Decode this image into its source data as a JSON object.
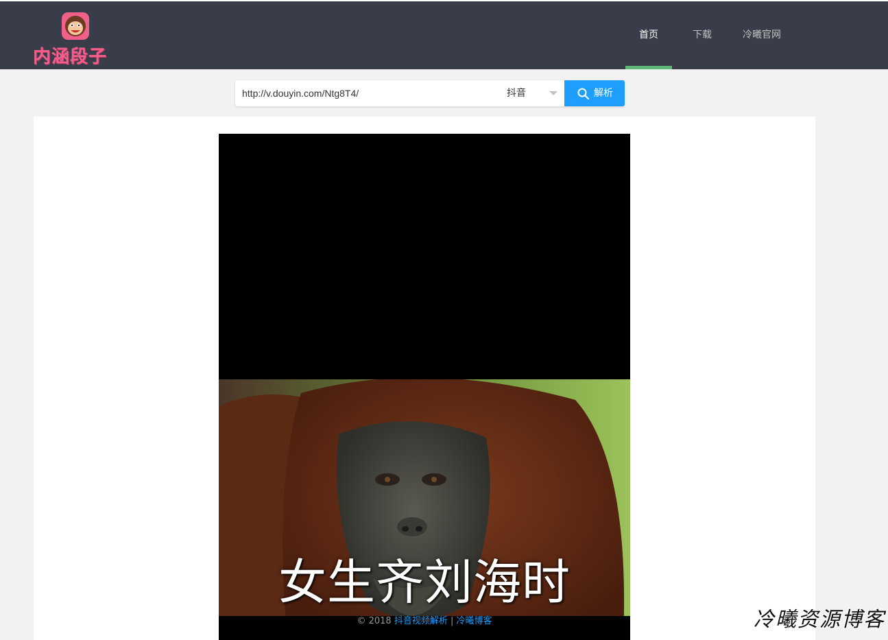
{
  "brand": {
    "name": "内涵段子"
  },
  "nav": {
    "items": [
      {
        "label": "首页",
        "active": true
      },
      {
        "label": "下载",
        "active": false
      },
      {
        "label": "冷曦官网",
        "active": false
      }
    ]
  },
  "search": {
    "url_value": "http://v.douyin.com/Ntg8T4/",
    "platform_selected": "抖音",
    "button_label": "解析"
  },
  "video": {
    "subtitle": "女生齐刘海时"
  },
  "footer": {
    "copyright": "© 2018",
    "link1": "抖音视频解析",
    "separator": "|",
    "link2": "冷曦博客"
  },
  "watermark": "冷曦资源博客",
  "colors": {
    "header_bg": "#393d49",
    "nav_active_indicator": "#5fb878",
    "button_blue": "#1e9fff",
    "brand_pink": "#f0608a"
  }
}
